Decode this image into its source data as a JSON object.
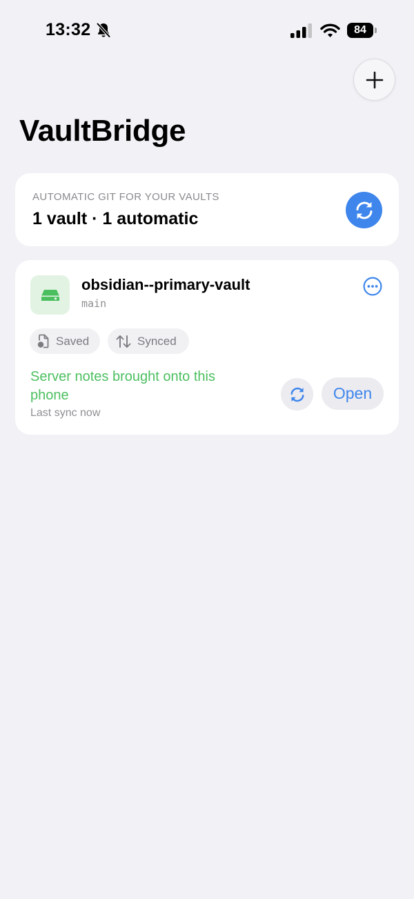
{
  "status_bar": {
    "time": "13:32",
    "battery_level": "84",
    "icons": [
      "bell-slash-icon",
      "cellular-signal-icon",
      "wifi-icon",
      "battery-icon"
    ]
  },
  "header": {
    "title": "VaultBridge",
    "add_icon": "plus-icon"
  },
  "summary": {
    "caption": "AUTOMATIC GIT FOR YOUR VAULTS",
    "value": "1 vault · 1 automatic",
    "sync_icon": "sync-icon"
  },
  "vaults": [
    {
      "name": "obsidian--primary-vault",
      "branch": "main",
      "icon": "drive-icon",
      "chips": [
        {
          "label": "Saved",
          "icon": "document-saved-icon"
        },
        {
          "label": "Synced",
          "icon": "up-down-arrows-icon"
        }
      ],
      "status_message": "Server notes brought onto this phone",
      "last_sync": "Last sync now",
      "open_label": "Open"
    }
  ],
  "colors": {
    "background": "#f1f1f6",
    "accent": "#3f86ec",
    "success": "#4bbf5f",
    "secondary_text": "#8e8e93"
  }
}
